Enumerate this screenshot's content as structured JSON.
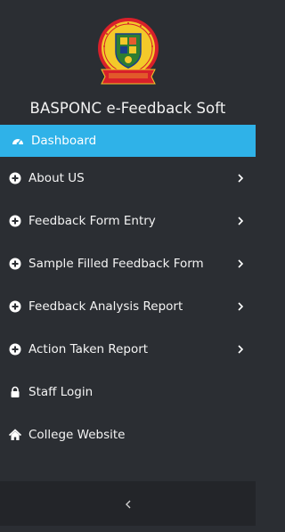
{
  "brand": {
    "title": "BASPONC e-Feedback Soft"
  },
  "colors": {
    "sidebar_bg": "#2b2e33",
    "active_bg": "#2fb2e8",
    "collapse_bg": "#232529",
    "text": "#f4f4f4"
  },
  "menu": {
    "items": [
      {
        "label": "Dashboard",
        "icon": "dashboard-icon",
        "active": true,
        "has_submenu": false
      },
      {
        "label": "About US",
        "icon": "plus-circle-icon",
        "active": false,
        "has_submenu": true
      },
      {
        "label": "Feedback Form Entry",
        "icon": "plus-circle-icon",
        "active": false,
        "has_submenu": true
      },
      {
        "label": "Sample Filled Feedback Form",
        "icon": "plus-circle-icon",
        "active": false,
        "has_submenu": true
      },
      {
        "label": "Feedback Analysis Report",
        "icon": "plus-circle-icon",
        "active": false,
        "has_submenu": true
      },
      {
        "label": "Action Taken Report",
        "icon": "plus-circle-icon",
        "active": false,
        "has_submenu": true
      },
      {
        "label": "Staff Login",
        "icon": "lock-icon",
        "active": false,
        "has_submenu": false
      },
      {
        "label": "College Website",
        "icon": "home-icon",
        "active": false,
        "has_submenu": false
      }
    ]
  },
  "collapse": {
    "icon": "chevron-left-icon"
  }
}
